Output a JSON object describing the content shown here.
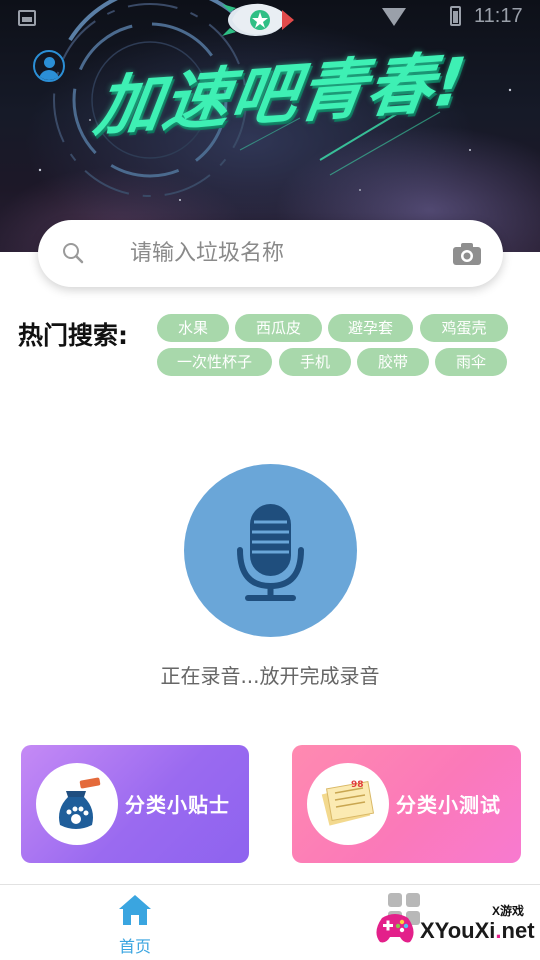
{
  "status_bar": {
    "time": "11:17"
  },
  "banner": {
    "slogan": "加速吧青春!",
    "colors": {
      "slogan": "#3ef0b4",
      "avatar": "#2b8fd6"
    }
  },
  "search": {
    "placeholder": "请输入垃圾名称",
    "search_icon": "search-icon",
    "camera_icon": "camera-icon"
  },
  "hot_search": {
    "label": "热门搜索:",
    "tags": [
      "水果",
      "西瓜皮",
      "避孕套",
      "鸡蛋壳",
      "一次性杯子",
      "手机",
      "胶带",
      "雨伞"
    ],
    "tag_color": "#a8d8ab"
  },
  "voice": {
    "icon": "microphone-icon",
    "status": "正在录音...放开完成录音",
    "button_color": "#6aa6d8"
  },
  "cards": {
    "tips": {
      "label": "分类小贴士",
      "icon": "trash-bag-icon"
    },
    "quiz": {
      "label": "分类小测试",
      "icon": "test-paper-icon"
    }
  },
  "bottom_nav": {
    "home_label": "首页",
    "home_icon": "home-icon",
    "second_icon": "grid-icon",
    "active_color": "#3aa5e0"
  },
  "watermark": {
    "tag": "X游戏",
    "site_prefix": "XYouXi",
    "site_dot": ".",
    "site_suffix": "net"
  }
}
